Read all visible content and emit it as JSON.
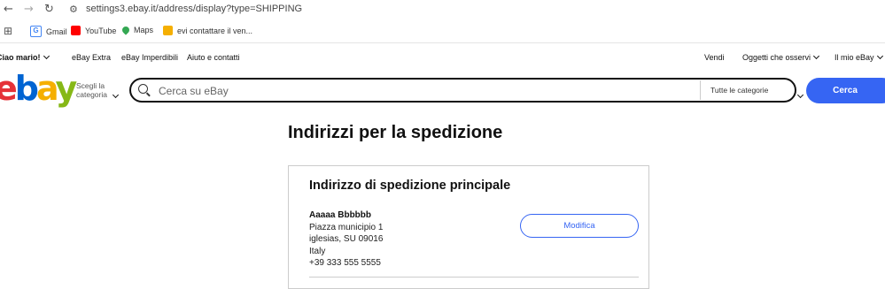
{
  "browser": {
    "url": "settings3.ebay.it/address/display?type=SHIPPING",
    "bookmarks": [
      {
        "label": "Gmail",
        "icon": "gmail-icon",
        "color": "#4285f4"
      },
      {
        "label": "YouTube",
        "icon": "youtube-icon",
        "color": "#ff0000"
      },
      {
        "label": "Maps",
        "icon": "maps-icon",
        "color": "#34a853"
      },
      {
        "label": "evi contattare il ven...",
        "icon": "bag-icon",
        "color": "#f5af02"
      }
    ]
  },
  "ebay_nav": {
    "greeting": "Ciao mario!",
    "left_links": [
      "eBay Extra",
      "eBay Imperdibili",
      "Aiuto e contatti"
    ],
    "right_links": [
      "Vendi",
      "Oggetti che osservi",
      "Il mio eBay"
    ]
  },
  "header": {
    "logo_letters": [
      "e",
      "b",
      "a",
      "y"
    ],
    "category_picker": [
      "Scegli la",
      "categoria"
    ],
    "search_placeholder": "Cerca su eBay",
    "category_select": "Tutte le categorie",
    "search_button": "Cerca",
    "brand_blue": "#3665f3"
  },
  "main": {
    "page_title": "Indirizzi per la spedizione",
    "card": {
      "title": "Indirizzo di spedizione principale",
      "name": "Aaaaa Bbbbbb",
      "lines": [
        "Piazza municipio 1",
        "iglesias, SU 09016",
        "Italy",
        "+39 333 555 5555"
      ],
      "edit_button": "Modifica"
    }
  }
}
